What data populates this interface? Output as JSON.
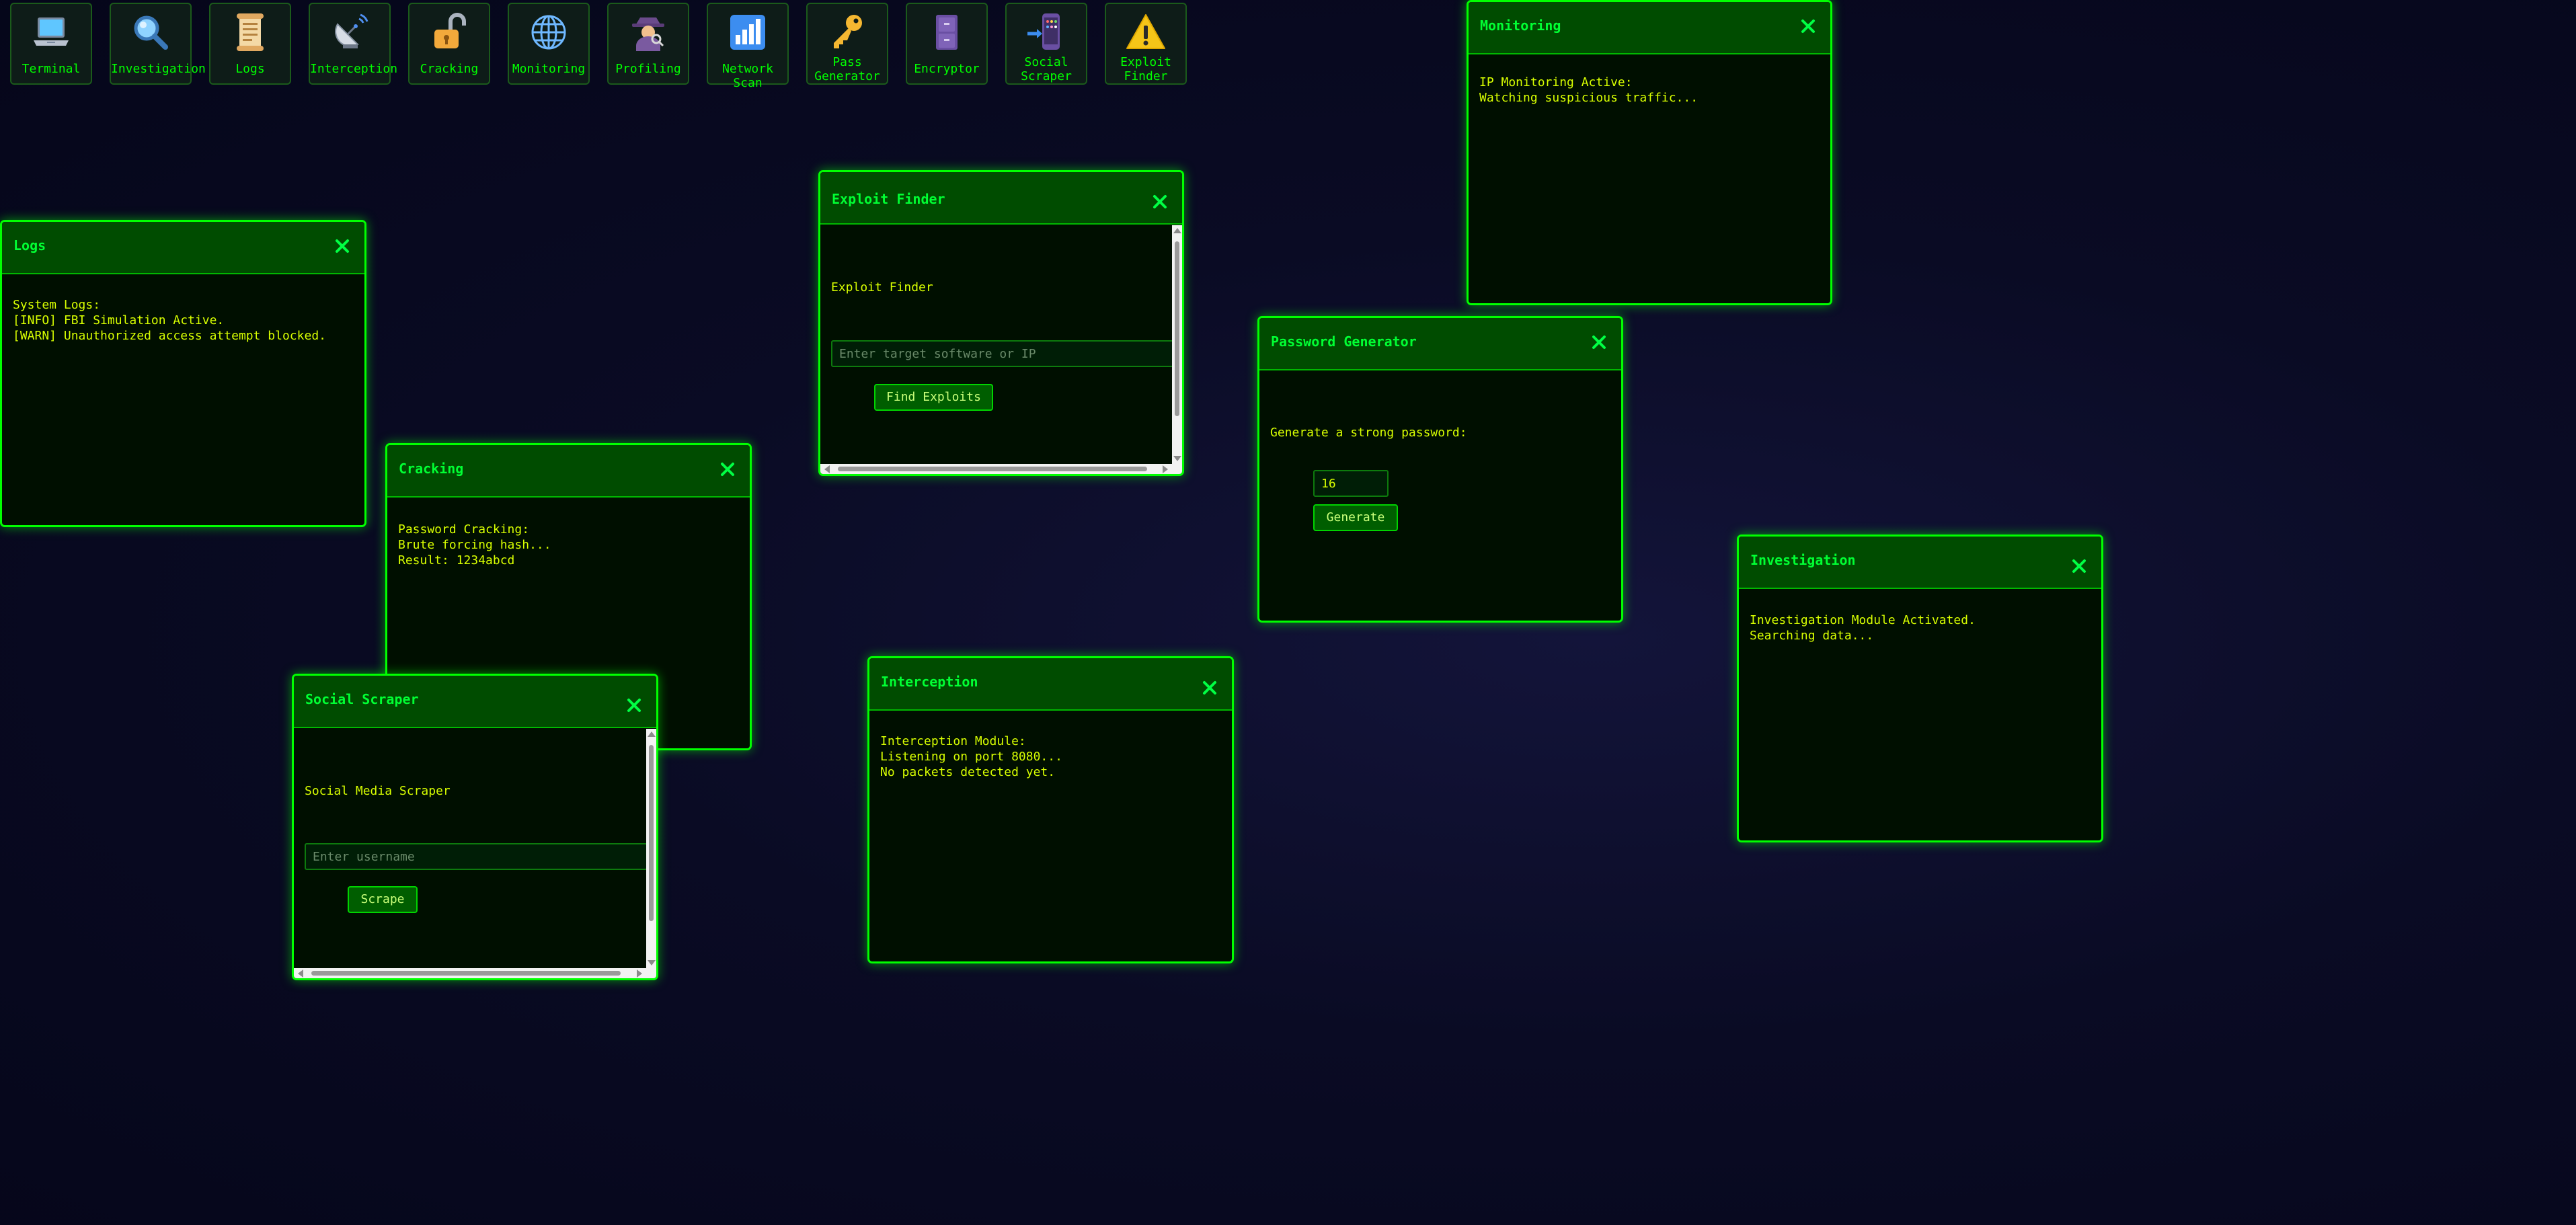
{
  "toolbar": {
    "items": [
      {
        "label": "Terminal",
        "icon": "laptop-icon"
      },
      {
        "label": "Investigation",
        "icon": "magnifier-icon"
      },
      {
        "label": "Logs",
        "icon": "scroll-icon"
      },
      {
        "label": "Interception",
        "icon": "satellite-dish-icon"
      },
      {
        "label": "Cracking",
        "icon": "unlocked-padlock-icon"
      },
      {
        "label": "Monitoring",
        "icon": "globe-icon"
      },
      {
        "label": "Profiling",
        "icon": "detective-icon"
      },
      {
        "label": "Network Scan",
        "icon": "bar-chart-icon"
      },
      {
        "label_line1": "Pass",
        "label_line2": "Generator",
        "icon": "key-icon"
      },
      {
        "label": "Encryptor",
        "icon": "file-cabinet-icon"
      },
      {
        "label_line1": "Social",
        "label_line2": "Scraper",
        "icon": "phone-arrow-icon"
      },
      {
        "label_line1": "Exploit",
        "label_line2": "Finder",
        "icon": "warning-icon"
      }
    ]
  },
  "windows": {
    "monitoring": {
      "title": "Monitoring",
      "lines": [
        "IP Monitoring Active:",
        "Watching suspicious traffic..."
      ]
    },
    "exploit_finder": {
      "title": "Exploit Finder",
      "heading": "Exploit Finder",
      "input_placeholder": "Enter target software or IP",
      "input_value": "",
      "button_label": "Find Exploits"
    },
    "logs": {
      "title": "Logs",
      "lines": [
        "System Logs:",
        "[INFO] FBI Simulation Active.",
        "[WARN] Unauthorized access attempt blocked."
      ]
    },
    "password_generator": {
      "title": "Password Generator",
      "heading": "Generate a strong password:",
      "length_value": "16",
      "button_label": "Generate"
    },
    "cracking": {
      "title": "Cracking",
      "lines": [
        "Password Cracking:",
        "Brute forcing hash...",
        "Result: 1234abcd"
      ]
    },
    "investigation": {
      "title": "Investigation",
      "lines": [
        "Investigation Module Activated.",
        "Searching data..."
      ]
    },
    "interception": {
      "title": "Interception",
      "lines": [
        "Interception Module:",
        "Listening on port 8080...",
        "No packets detected yet."
      ]
    },
    "social_scraper": {
      "title": "Social Scraper",
      "heading": "Social Media Scraper",
      "input_placeholder": "Enter username",
      "input_value": "",
      "button_label": "Scrape"
    }
  },
  "colors": {
    "accent": "#00ff00",
    "body_text": "#d8ff00",
    "titlebar": "#004c00",
    "window_bg": "#000f00",
    "desktop_bg": "#0a0b24"
  }
}
